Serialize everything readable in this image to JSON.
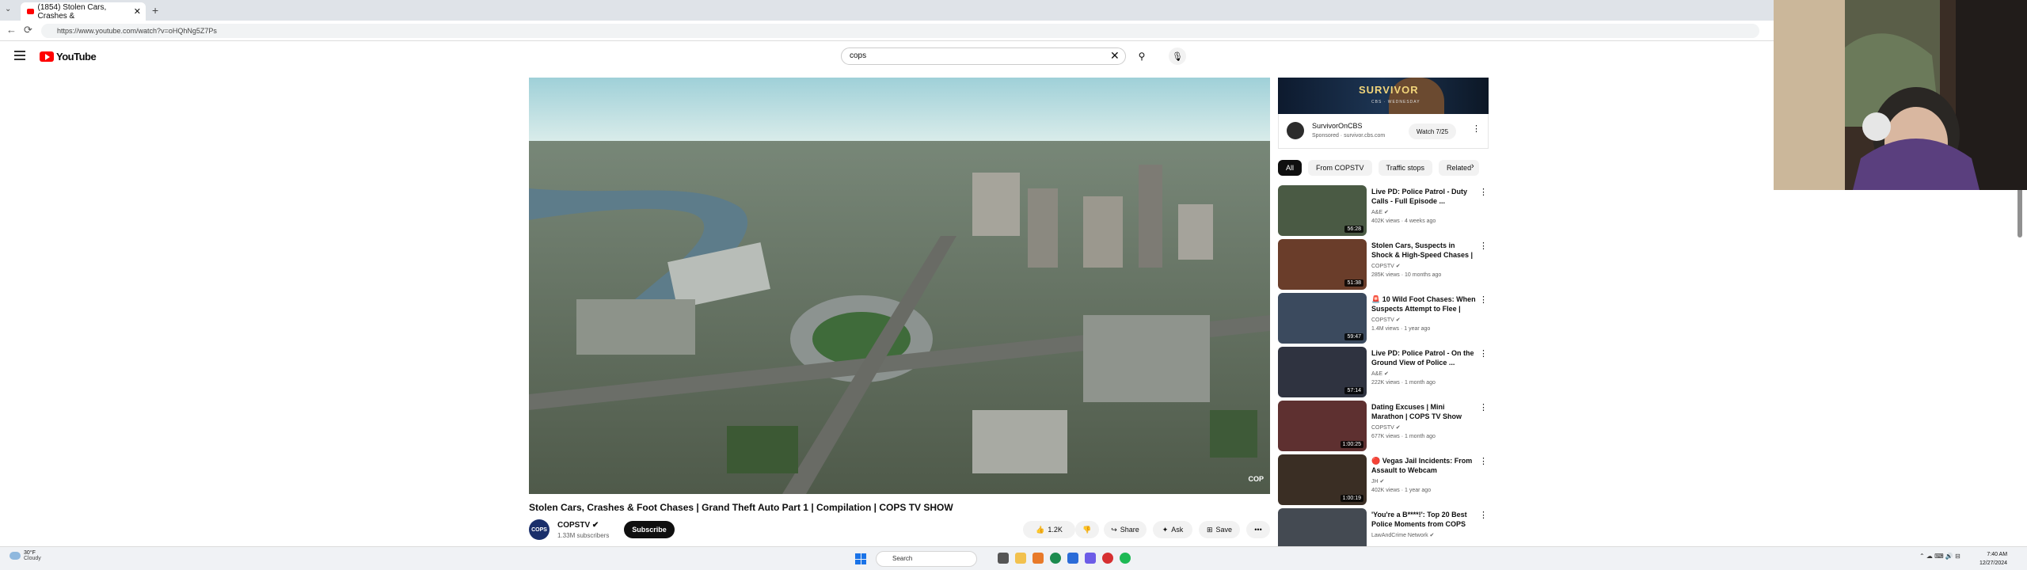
{
  "browser": {
    "tab_title": "(1854) Stolen Cars, Crashes &",
    "tab_close": "✕",
    "new_tab": "+",
    "tab_menu": "⌄",
    "url": "https://www.youtube.com/watch?v=oHQhNg5Z7Ps",
    "back": "←",
    "reload": "⟳"
  },
  "youtube": {
    "logo_text": "YouTube",
    "search_value": "cops",
    "search_clear": "✕",
    "search_icon": "⚲",
    "mic_icon": "🎙"
  },
  "video": {
    "title": "Stolen Cars, Crashes & Foot Chases | Grand Theft Auto Part 1 | Compilation | COPS TV SHOW",
    "watermark": "COP",
    "channel_avatar": "COPS",
    "channel_name": "COPSTV ✔",
    "channel_subs": "1.33M subscribers",
    "subscribe": "Subscribe",
    "like_count": "1.2K",
    "share": "Share",
    "ask": "Ask",
    "save": "Save",
    "more": "•••"
  },
  "ad": {
    "banner_title": "SURVIVOR",
    "banner_sub": "CBS · WEDNESDAY",
    "name": "SurvivorOnCBS",
    "sponsor": "Sponsored · survivor.cbs.com",
    "watch": "Watch 7/25",
    "more": "⋮"
  },
  "chips": [
    "All",
    "From COPSTV",
    "Traffic stops",
    "Related"
  ],
  "chip_next": "›",
  "recommendations": [
    {
      "title": "Live PD: Police Patrol - Duty Calls - Full Episode ...",
      "channel": "A&E ✔",
      "meta": "402K views · 4 weeks ago",
      "duration": "56:28",
      "color": "#4a5a44"
    },
    {
      "title": "Stolen Cars, Suspects in Shock & High-Speed Chases | ...",
      "channel": "COPSTV ✔",
      "meta": "285K views · 10 months ago",
      "duration": "51:38",
      "color": "#6a3d2a"
    },
    {
      "title": "🚨 10 Wild Foot Chases: When Suspects Attempt to Flee | Co...",
      "channel": "COPSTV ✔",
      "meta": "1.4M views · 1 year ago",
      "duration": "59:47",
      "color": "#3b4a5e"
    },
    {
      "title": "Live PD: Police Patrol - On the Ground View of Police ...",
      "channel": "A&E ✔",
      "meta": "222K views · 1 month ago",
      "duration": "57:14",
      "color": "#2f3340"
    },
    {
      "title": "Dating Excuses | Mini Marathon | COPS TV Show",
      "channel": "COPSTV ✔",
      "meta": "677K views · 1 month ago",
      "duration": "1:00:25",
      "color": "#5e3030"
    },
    {
      "title": "🔴 Vegas Jail Incidents: From Assault to Webcam Revelation...",
      "channel": "JH ✔",
      "meta": "402K views · 1 year ago",
      "duration": "1:00:19",
      "color": "#3a2e24"
    },
    {
      "title": "'You're a B****!': Top 20 Best Police Moments from COPS",
      "channel": "LawAndCrime Network ✔",
      "meta": "",
      "duration": "",
      "color": "#444a52"
    }
  ],
  "rec_more": "⋮",
  "taskbar": {
    "weather_temp": "30°F",
    "weather_text": "Cloudy",
    "search_placeholder": "Search",
    "tray": "⌃  ☁  ⌨  🔊  ⊟",
    "time": "7:40 AM",
    "date": "12/27/2024"
  },
  "colors": {
    "yt_red": "#ff0000",
    "subscribe_bg": "#0f0f0f",
    "chip_bg": "#f2f2f2"
  }
}
